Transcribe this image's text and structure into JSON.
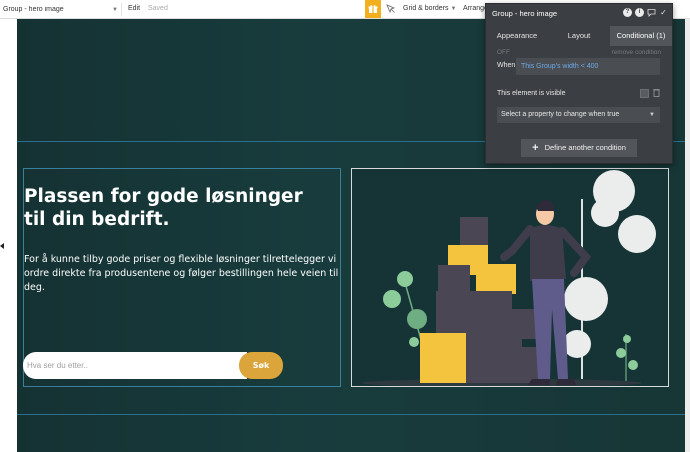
{
  "toolbar": {
    "element_select": "Group - hero image",
    "edit_label": "Edit",
    "saved_label": "Saved",
    "grid_label": "Grid & borders",
    "arrange_label": "Arrange",
    "gift_color": "#f2b01e"
  },
  "hero": {
    "headline_line1": "Plassen for gode løsninger",
    "headline_line2": "til din bedrift.",
    "body": "For å kunne tilby gode priser og flexible løsninger tilrettelegger vi ordre direkte fra produsentene og følger bestillingen hele veien til deg.",
    "search_placeholder": "Hva ser du etter..",
    "search_button": "Søk",
    "accent_color": "#dba53b",
    "background_color": "#173636"
  },
  "panel": {
    "title": "Group - hero image",
    "icons": [
      "help-icon",
      "info-icon",
      "comment-icon",
      "check-icon"
    ],
    "icon_labels": [
      "?",
      "i",
      "✓"
    ],
    "tabs": [
      {
        "label": "Appearance",
        "active": false
      },
      {
        "label": "Layout",
        "active": false
      },
      {
        "label": "Conditional (1)",
        "active": true
      }
    ],
    "off_label": "OFF",
    "remove_label": "remove condition",
    "when_label": "When",
    "condition_expression": "This Group's width < 400",
    "visible_label": "This element is visible",
    "select_placeholder": "Select a property to change when true",
    "define_label": "Define another condition",
    "expression_color": "#6fa9e6"
  }
}
